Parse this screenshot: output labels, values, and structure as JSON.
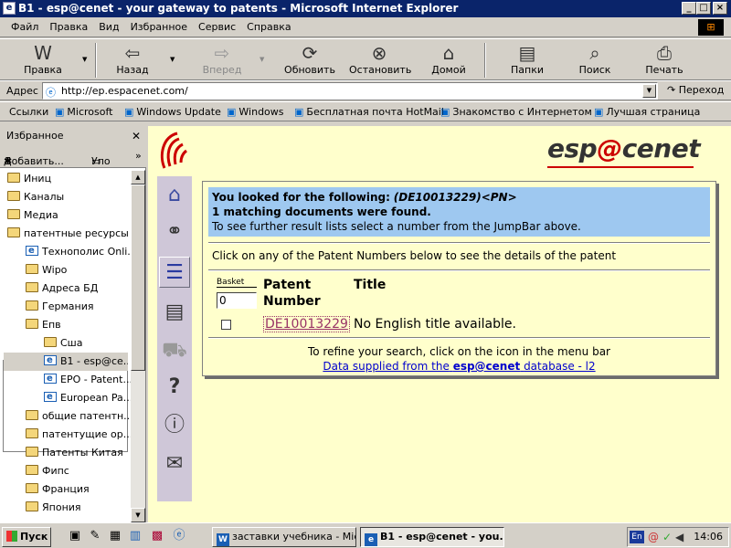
{
  "window": {
    "title": "B1 - esp@cenet - your gateway to patents - Microsoft Internet Explorer"
  },
  "menu": [
    "Файл",
    "Правка",
    "Вид",
    "Избранное",
    "Сервис",
    "Справка"
  ],
  "toolbar": {
    "edit": "Правка",
    "back": "Назад",
    "forward": "Вперед",
    "refresh": "Обновить",
    "stop": "Остановить",
    "home": "Домой",
    "folders": "Папки",
    "search": "Поиск",
    "print": "Печать"
  },
  "address": {
    "label": "Адрес",
    "url": "http://ep.espacenet.com/",
    "go": "Переход"
  },
  "links": {
    "label": "Ссылки",
    "items": [
      "Microsoft",
      "Windows Update",
      "Windows",
      "Бесплатная почта HotMail",
      "Знакомство с Интернетом",
      "Лучшая страница"
    ]
  },
  "sidebar": {
    "title": "Избранное",
    "add": "Добавить...",
    "organize": "Упо",
    "items": [
      {
        "label": "Иниц",
        "type": "folder"
      },
      {
        "label": "Каналы",
        "type": "folder"
      },
      {
        "label": "Медиа",
        "type": "folder"
      },
      {
        "label": "патентные ресурсы",
        "type": "folder"
      },
      {
        "label": "Технополис Onli...",
        "type": "page"
      },
      {
        "label": "Wipo",
        "type": "folder"
      },
      {
        "label": "Адреса БД",
        "type": "folder"
      },
      {
        "label": "Германия",
        "type": "folder"
      },
      {
        "label": "Епв",
        "type": "folder"
      },
      {
        "label": "Сша",
        "type": "folder"
      },
      {
        "label": "B1 - esp@ce...",
        "type": "page"
      },
      {
        "label": "EPO - Patent...",
        "type": "page"
      },
      {
        "label": "European Pa...",
        "type": "page"
      },
      {
        "label": "общие патентн...",
        "type": "folder"
      },
      {
        "label": "патентущие ор...",
        "type": "folder"
      },
      {
        "label": "Патенты Китая",
        "type": "folder"
      },
      {
        "label": "Фипс",
        "type": "folder"
      },
      {
        "label": "Франция",
        "type": "folder"
      },
      {
        "label": "Япония",
        "type": "folder"
      }
    ]
  },
  "logo": {
    "pre": "esp",
    "at": "@",
    "post": "cenet"
  },
  "results": {
    "looked_prefix": "You looked for the following:",
    "query": "(DE10013229)<PN>",
    "found": "1 matching documents were found.",
    "jumpbar": "To see further result lists select a number from the JumpBar above.",
    "click_msg": "Click on any of the Patent Numbers below to see the details of the patent",
    "basket_label": "Basket",
    "basket_value": "0",
    "col_patent": "Patent",
    "col_number": "Number",
    "col_title": "Title",
    "rows": [
      {
        "patent": "DE10013229",
        "title": "No English title available."
      }
    ],
    "refine": "To refine your search, click on the icon in the menu bar",
    "data_pre": "Data supplied from the",
    "data_brand": "esp@cenet",
    "data_post": "database - l2"
  },
  "taskbar": {
    "start": "Пуск",
    "tasks": [
      "заставки учебника - Micr...",
      "B1 - esp@cenet - you..."
    ],
    "lang": "En",
    "clock": "14:06"
  },
  "colors": {
    "titlebar": "#0a246a",
    "content_bg": "#ffffcc",
    "result_header_bg": "#9ec8f0",
    "logo_red": "#cc0000"
  }
}
